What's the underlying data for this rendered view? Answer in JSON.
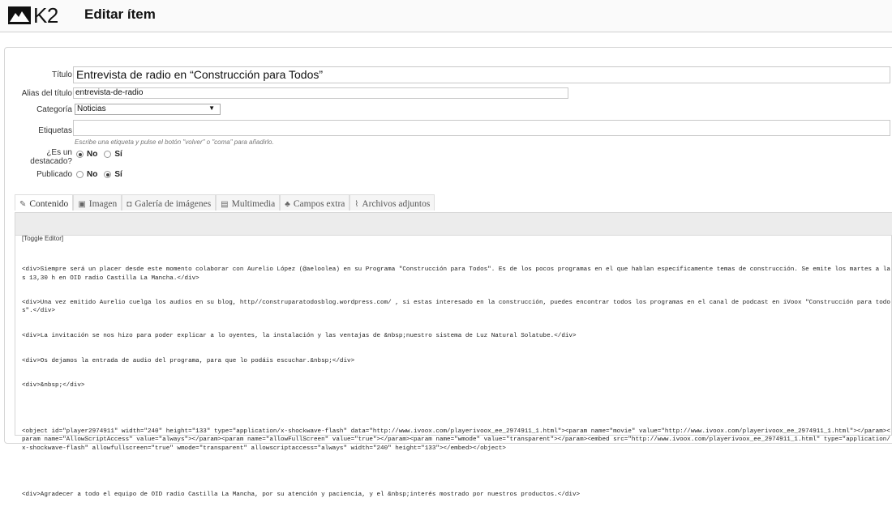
{
  "header": {
    "logo_text": "K2",
    "title": "Editar ítem"
  },
  "form": {
    "title_label": "Título",
    "title_value": "Entrevista de radio en “Construcción para Todos”",
    "alias_label": "Alias del título",
    "alias_value": "entrevista-de-radio",
    "category_label": "Categoría",
    "category_value": "Noticias",
    "tags_label": "Etiquetas",
    "tags_hint": "Escribe una etiqueta y pulse el botón \"volver\" o \"coma\" para añadirlo.",
    "featured_label_1": "¿Es un",
    "featured_label_2": "destacado?",
    "featured_no": "No",
    "featured_yes": "Sí",
    "featured_selected": "No",
    "published_label": "Publicado",
    "published_no": "No",
    "published_yes": "Sí",
    "published_selected": "Sí"
  },
  "tabs": [
    {
      "label": "Contenido",
      "icon": "edit-icon",
      "active": true
    },
    {
      "label": "Imagen",
      "icon": "image-icon",
      "active": false
    },
    {
      "label": "Galería de imágenes",
      "icon": "camera-icon",
      "active": false
    },
    {
      "label": "Multimedia",
      "icon": "film-icon",
      "active": false
    },
    {
      "label": "Campos extra",
      "icon": "tools-icon",
      "active": false
    },
    {
      "label": "Archivos adjuntos",
      "icon": "paperclip-icon",
      "active": false
    }
  ],
  "editor": {
    "toggle_label": "[Toggle Editor]",
    "lines": [
      "<div>Siempre será un placer desde este momento colaborar con Aurelio López (@aeloolea) en su Programa \"Construcción para Todos\". Es de los pocos programas en el que hablan específicamente temas de construcción. Se emite los martes a las 13,30 h en OID radio Castilla La Mancha.</div>",
      "<div>Una vez emitido Aurelio cuelga los audios en su blog, http//construparatodosblog.wordpress.com/ , si estas interesado en la construcción, puedes encontrar todos los programas en el canal de podcast en iVoox \"Construcción para todos\".</div>",
      "<div>La invitación se nos hizo para poder explicar a lo oyentes, la instalación y las ventajas de &nbsp;nuestro sistema de Luz Natural Solatube.</div>",
      "<div>Os dejamos la entrada de audio del programa, para que lo podáis escuchar.&nbsp;</div>",
      "<div>&nbsp;</div>",
      "",
      "<object id=\"player2974911\" width=\"240\" height=\"133\" type=\"application/x-shockwave-flash\" data=\"http://www.ivoox.com/playerivoox_ee_2974911_1.html\"><param name=\"movie\" value=\"http://www.ivoox.com/playerivoox_ee_2974911_1.html\"></param><param name=\"AllowScriptAccess\" value=\"always\"></param><param name=\"allowFullScreen\" value=\"true\"></param><param name=\"wmode\" value=\"transparent\"></param><embed src=\"http://www.ivoox.com/playerivoox_ee_2974911_1.html\" type=\"application/x-shockwave-flash\" allowfullscreen=\"true\" wmode=\"transparent\" allowscriptaccess=\"always\" width=\"240\" height=\"133\"></embed></object>",
      "",
      "<div>Agradecer a todo el equipo de OID radio Castilla La Mancha, por su atención y paciencia, y el &nbsp;interés mostrado por nuestros productos.</div>"
    ]
  }
}
